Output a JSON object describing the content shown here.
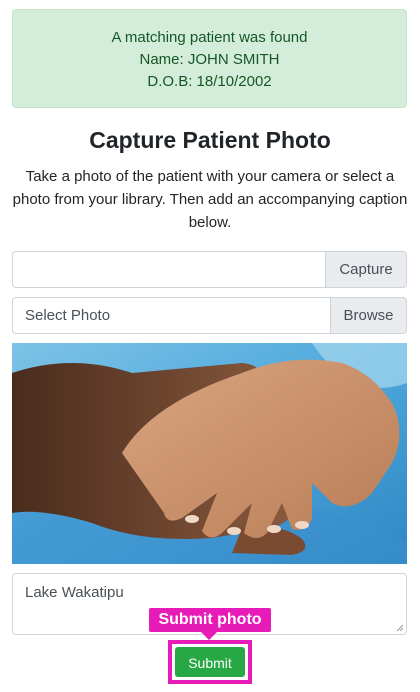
{
  "alert": {
    "line1": "A matching patient was found",
    "line2": "Name: JOHN SMITH",
    "line3": "D.O.B: 18/10/2002"
  },
  "heading": "Capture Patient Photo",
  "description": "Take a photo of the patient with your camera or select a photo from your library. Then add an accompanying caption below.",
  "capture_group": {
    "value": "",
    "button_label": "Capture"
  },
  "select_group": {
    "value": "Select Photo",
    "button_label": "Browse"
  },
  "caption_value": "Lake Wakatipu",
  "tooltip": "Submit photo",
  "submit_label": "Submit",
  "colors": {
    "alert_bg": "#d4edda",
    "alert_text": "#155724",
    "submit_bg": "#28a745",
    "highlight": "#e61bb8"
  }
}
